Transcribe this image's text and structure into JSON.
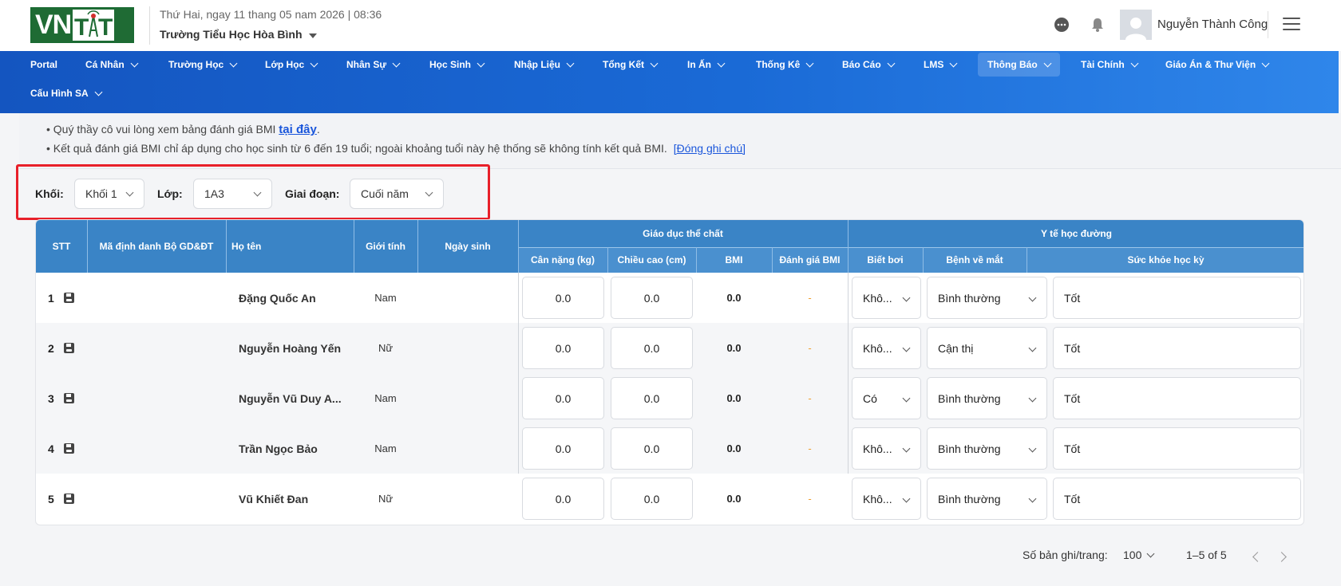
{
  "header": {
    "logo_text": "VNTT",
    "date": "Thứ Hai, ngay 11 thang 05 nam 2026 | 08:36",
    "school": "Trường Tiểu Học Hòa Bình",
    "username": "Nguyễn Thành Công",
    "icons": [
      "chat-icon",
      "bell-icon",
      "user-avatar-icon",
      "menu-icon"
    ]
  },
  "nav": {
    "items": [
      {
        "label": "Portal",
        "caret": false
      },
      {
        "label": "Cá Nhân",
        "caret": true
      },
      {
        "label": "Trường Học",
        "caret": true
      },
      {
        "label": "Lớp Học",
        "caret": true
      },
      {
        "label": "Nhân Sự",
        "caret": true
      },
      {
        "label": "Học Sinh",
        "caret": true
      },
      {
        "label": "Nhập Liệu",
        "caret": true
      },
      {
        "label": "Tổng Kết",
        "caret": true
      },
      {
        "label": "In Ấn",
        "caret": true
      },
      {
        "label": "Thống Kê",
        "caret": true
      },
      {
        "label": "Báo Cáo",
        "caret": true
      },
      {
        "label": "LMS",
        "caret": true
      },
      {
        "label": "Thông Báo",
        "caret": true,
        "active": true
      },
      {
        "label": "Tài Chính",
        "caret": true
      },
      {
        "label": "Giáo Án & Thư Viện",
        "caret": true
      },
      {
        "label": "Cấu Hình SA",
        "caret": true
      }
    ]
  },
  "notes": {
    "line1_prefix": "• Quý thầy cô vui lòng xem bảng đánh giá BMI ",
    "line1_link": "tại đây",
    "line1_suffix": ".",
    "line2_text": "• Kết quả đánh giá BMI chỉ áp dụng cho học sinh từ 6 đến 19 tuổi; ngoài khoảng tuổi này hệ thống sẽ không tính kết quả BMI.",
    "line2_link": "[Đóng ghi chú]"
  },
  "filters": {
    "grade_label": "Khối:",
    "grade_value": "Khối 1",
    "class_label": "Lớp:",
    "class_value": "1A3",
    "period_label": "Giai đoạn:",
    "period_value": "Cuối năm"
  },
  "table": {
    "headers": {
      "stt": "STT",
      "id": "Mã định danh Bộ GD&ĐT",
      "name": "Họ tên",
      "gender": "Giới tính",
      "dob": "Ngày sinh",
      "pe_group": "Giáo dục thể chất",
      "weight": "Cân nặng (kg)",
      "height": "Chiều cao (cm)",
      "bmi": "BMI",
      "bmi_eval": "Đánh giá BMI",
      "health_group": "Y tế học đường",
      "swim": "Biết bơi",
      "eye": "Bệnh về mắt",
      "term_health": "Sức khỏe học kỳ"
    },
    "rows": [
      {
        "stt": "1",
        "name": "Đặng Quốc An",
        "gender": "Nam",
        "weight": "0.0",
        "height": "0.0",
        "bmi": "0.0",
        "eval": "-",
        "swim": "Khô...",
        "eye": "Bình thường",
        "health": "Tốt"
      },
      {
        "stt": "2",
        "name": "Nguyễn Hoàng Yến",
        "gender": "Nữ",
        "weight": "0.0",
        "height": "0.0",
        "bmi": "0.0",
        "eval": "-",
        "swim": "Khô...",
        "eye": "Cận thị",
        "health": "Tốt"
      },
      {
        "stt": "3",
        "name": "Nguyễn Vũ Duy A...",
        "gender": "Nam",
        "weight": "0.0",
        "height": "0.0",
        "bmi": "0.0",
        "eval": "-",
        "swim": "Có",
        "eye": "Bình thường",
        "health": "Tốt"
      },
      {
        "stt": "4",
        "name": "Trần Ngọc Bảo",
        "gender": "Nam",
        "weight": "0.0",
        "height": "0.0",
        "bmi": "0.0",
        "eval": "-",
        "swim": "Khô...",
        "eye": "Bình thường",
        "health": "Tốt"
      },
      {
        "stt": "5",
        "name": "Vũ Khiết Đan",
        "gender": "Nữ",
        "weight": "0.0",
        "height": "0.0",
        "bmi": "0.0",
        "eval": "-",
        "swim": "Khô...",
        "eye": "Bình thường",
        "health": "Tốt"
      }
    ]
  },
  "pager": {
    "per_page_label": "Số bản ghi/trang:",
    "per_page_value": "100",
    "range": "1–5 of 5"
  },
  "colors": {
    "nav_start": "#1455c0",
    "nav_end": "#2f86ea",
    "table_header": "#3a84c6",
    "highlight_box": "#e8202a",
    "link": "#1a56db",
    "eval_dash": "#f0a030"
  }
}
